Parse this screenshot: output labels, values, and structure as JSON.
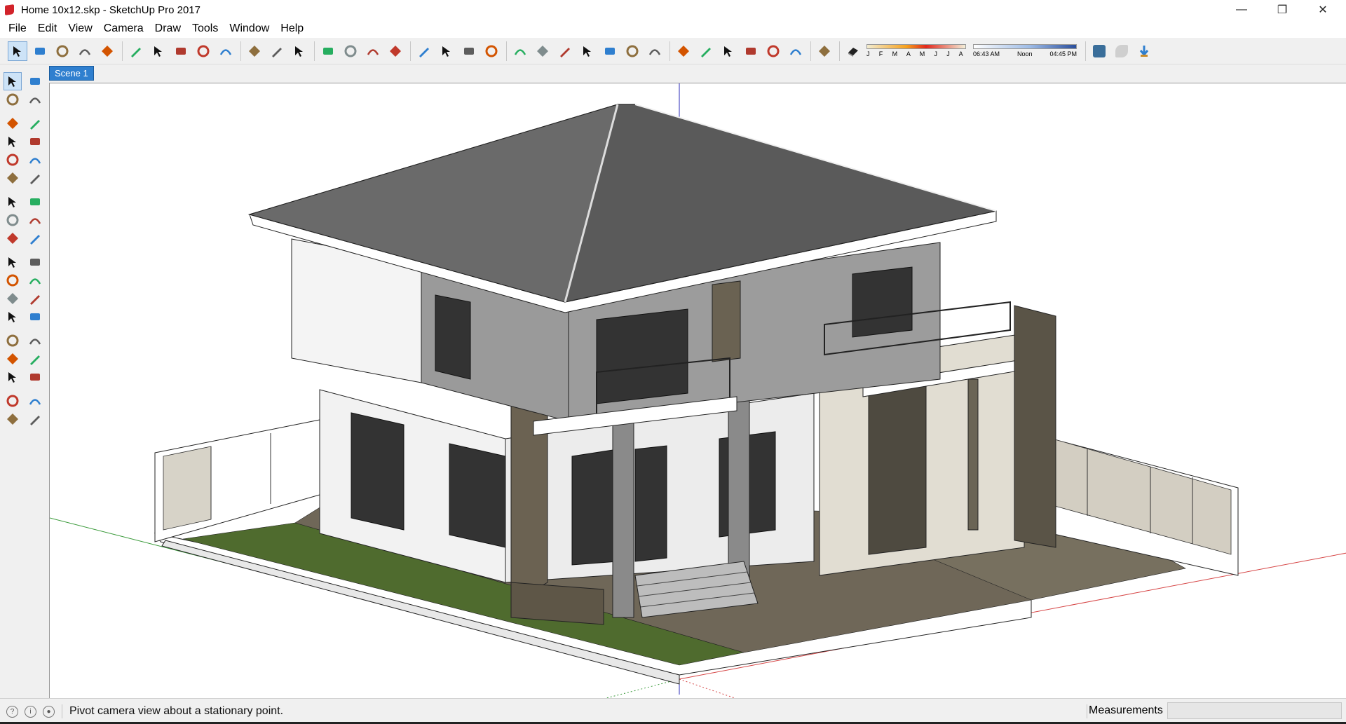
{
  "window": {
    "title": "Home 10x12.skp - SketchUp Pro 2017",
    "controls": {
      "minimize": "—",
      "restore": "❐",
      "close": "✕"
    }
  },
  "menu": [
    "File",
    "Edit",
    "View",
    "Camera",
    "Draw",
    "Tools",
    "Window",
    "Help"
  ],
  "toolbar": {
    "groups": [
      [
        "select-icon",
        "eraser-icon",
        "pencil-icon",
        "arc-icon",
        "rectangle-icon"
      ],
      [
        "push-pull-icon",
        "follow-me-icon",
        "move-icon",
        "rotate-icon",
        "scale-icon"
      ],
      [
        "tape-measure-icon",
        "text-icon",
        "paint-bucket-icon"
      ],
      [
        "orbit-icon",
        "pan-icon",
        "zoom-icon",
        "zoom-extents-icon"
      ],
      [
        "warehouse-icon",
        "extension-warehouse-icon",
        "layout-icon",
        "ruby-icon"
      ],
      [
        "xray-icon",
        "back-edges-icon",
        "wireframe-icon",
        "hidden-line-icon",
        "shaded-icon",
        "shaded-textures-icon",
        "monochrome-icon"
      ],
      [
        "iso-view-icon",
        "top-view-icon",
        "front-view-icon",
        "right-view-icon",
        "back-view-icon",
        "left-view-icon"
      ],
      [
        "shadows-toggle-icon"
      ]
    ],
    "shadow_months": "J F M A M J J A S O N D",
    "shadow_times": {
      "start": "06:43 AM",
      "mid": "Noon",
      "end": "04:45 PM"
    },
    "tail": [
      "geo-location-icon",
      "sandbox-icon",
      "add-location-icon"
    ]
  },
  "scene": {
    "tab": "Scene 1"
  },
  "left_tools": [
    "select-icon",
    "make-component-icon",
    "paint-bucket-icon",
    "eraser-icon",
    "line-icon",
    "freehand-icon",
    "rectangle-icon",
    "rotated-rectangle-icon",
    "circle-icon",
    "polygon-icon",
    "arc-icon",
    "two-point-arc-icon",
    "three-point-arc-icon",
    "pie-icon",
    "move-icon",
    "push-pull-icon",
    "rotate-icon",
    "follow-me-icon",
    "scale-icon",
    "offset-icon",
    "tape-measure-icon",
    "dimension-icon",
    "protractor-icon",
    "text-icon",
    "axes-icon",
    "3d-text-icon",
    "orbit-icon",
    "pan-icon",
    "zoom-icon",
    "zoom-window-icon",
    "zoom-extents-icon",
    "previous-view-icon",
    "position-camera-icon",
    "look-around-icon",
    "walk-icon",
    "section-plane-icon"
  ],
  "status": {
    "message": "Pivot camera view about a stationary point.",
    "measurements_label": "Measurements",
    "measurements_value": ""
  },
  "colors": {
    "accent": "#2f7fcf",
    "roof": "#5a5a5a",
    "wall": "#f4f4f4",
    "stone": "#6b6252",
    "grass": "#4f6b2e",
    "axis_red": "#d64545",
    "axis_green": "#3a9a3a",
    "axis_blue": "#2b2bb8"
  }
}
